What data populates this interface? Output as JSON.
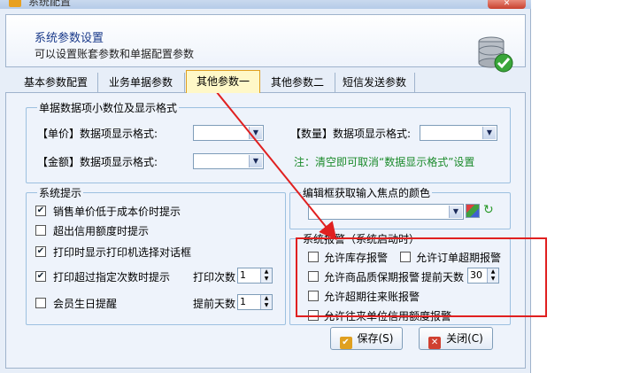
{
  "window": {
    "title": "系统配置",
    "close": "✕"
  },
  "header": {
    "title": "系统参数设置",
    "subtitle": "可以设置账套参数和单据配置参数"
  },
  "tabs": [
    {
      "label": "基本参数配置"
    },
    {
      "label": "业务单据参数"
    },
    {
      "label": "其他参数一"
    },
    {
      "label": "其他参数二"
    },
    {
      "label": "短信发送参数"
    }
  ],
  "decimal_group": {
    "title": "单据数据项小数位及显示格式",
    "price_label": "【单价】数据项显示格式:",
    "price_value": "",
    "qty_label": "【数量】数据项显示格式:",
    "qty_value": "",
    "amount_label": "【金额】数据项显示格式:",
    "amount_value": "",
    "note": "注：清空即可取消“数据显示格式”设置",
    "note_color": "#1a8a2a"
  },
  "prompt_group": {
    "title": "系统提示",
    "items": [
      {
        "label": "销售单价低于成本价时提示",
        "checked": true
      },
      {
        "label": "超出信用额度时提示",
        "checked": false
      },
      {
        "label": "打印时显示打印机选择对话框",
        "checked": true
      },
      {
        "label": "打印超过指定次数时提示",
        "checked": true
      },
      {
        "label": "会员生日提醒",
        "checked": false
      }
    ],
    "print_count_label": "打印次数",
    "print_count_value": "1",
    "days_ahead_label": "提前天数",
    "days_ahead_value": "1"
  },
  "color_group": {
    "title": "编辑框获取输入焦点的颜色",
    "value": ""
  },
  "alarm_group": {
    "title": "系统报警（系统启动时）",
    "items": [
      {
        "label": "允许库存报警",
        "checked": false
      },
      {
        "label": "允许订单超期报警",
        "checked": false
      },
      {
        "label": "允许商品质保期报警",
        "checked": false
      },
      {
        "label": "允许超期往来账报警",
        "checked": false
      },
      {
        "label": "允许往来单位信用额度报警",
        "checked": false
      }
    ],
    "days_ahead_label": "提前天数",
    "days_ahead_value": "30"
  },
  "buttons": {
    "save": "保存(S)",
    "close": "关闭(C)"
  },
  "colors": {
    "annotation": "#e02020",
    "active_tab": "#fff8c8"
  }
}
